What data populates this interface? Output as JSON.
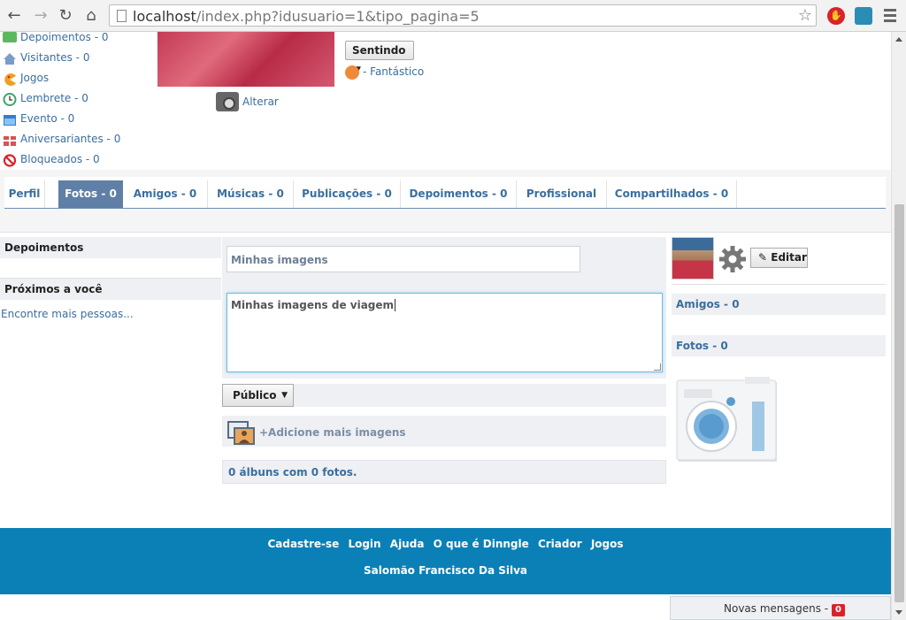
{
  "browser": {
    "url_host": "localhost",
    "url_rest": "/index.php?idusuario=1&tipo_pagina=5"
  },
  "left_menu": {
    "items": [
      {
        "label": "Depoimentos - 0",
        "icon": "speech-bubble-icon",
        "color": "#5cb85c"
      },
      {
        "label": "Visitantes - 0",
        "icon": "house-icon",
        "color": "#7a9cc8"
      },
      {
        "label": "Jogos",
        "icon": "pacman-icon",
        "color": "#f0a020"
      },
      {
        "label": "Lembrete - 0",
        "icon": "clock-icon",
        "color": "#3aa56b"
      },
      {
        "label": "Evento - 0",
        "icon": "calendar-icon",
        "color": "#2f7fd1"
      },
      {
        "label": "Aniversariantes - 0",
        "icon": "gift-icon",
        "color": "#d9534f"
      },
      {
        "label": "Bloqueados - 0",
        "icon": "block-icon",
        "color": "#d9232a"
      }
    ]
  },
  "profile": {
    "alterar_label": "Alterar",
    "sentindo_label": "Sentindo",
    "mood_text": "- Fantástico"
  },
  "tabs": [
    {
      "label": "Perfil",
      "active": false
    },
    {
      "label": "Fotos - 0",
      "active": true
    },
    {
      "label": "Amigos - 0",
      "active": false
    },
    {
      "label": "Músicas - 0",
      "active": false
    },
    {
      "label": "Publicações - 0",
      "active": false
    },
    {
      "label": "Depoimentos - 0",
      "active": false
    },
    {
      "label": "Profissional",
      "active": false
    },
    {
      "label": "Compartilhados - 0",
      "active": false
    }
  ],
  "sidebar_left": {
    "depoimentos_heading": "Depoimentos",
    "proximos_heading": "Próximos a você",
    "find_more_link": "Encontre mais pessoas..."
  },
  "album_form": {
    "title_value": "Minhas imagens",
    "description_value": "Minhas imagens de viagem",
    "privacy_value": "Público",
    "add_images_label": "+Adicione mais imagens",
    "album_count": "0 álbuns com 0 fotos."
  },
  "sidebar_right": {
    "edit_label": "Editar",
    "amigos_heading": "Amigos - 0",
    "fotos_heading": "Fotos - 0"
  },
  "footer": {
    "links": [
      "Cadastre-se",
      "Login",
      "Ajuda",
      "O que é Dinngle",
      "Criador",
      "Jogos"
    ],
    "user_name": "Salomão Francisco Da Silva"
  },
  "messages": {
    "label": "Novas mensagens -",
    "count": "0"
  },
  "colors": {
    "accent": "#5f7fa6",
    "link": "#3b6e9e",
    "footer": "#0b80b6"
  }
}
